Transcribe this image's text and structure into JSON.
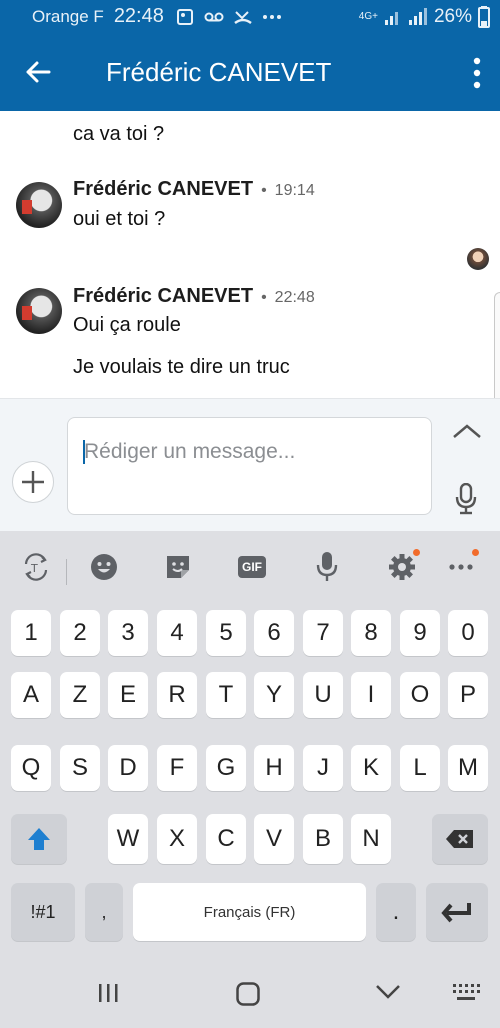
{
  "status": {
    "carrier": "Orange F",
    "time": "22:48",
    "network": "4G+",
    "battery": "26%"
  },
  "appbar": {
    "title": "Frédéric CANEVET"
  },
  "thread": {
    "prev_text": "ca va toi ?",
    "messages": [
      {
        "sender": "Frédéric CANEVET",
        "time": "19:14",
        "lines": [
          "oui et toi ?"
        ]
      },
      {
        "sender": "Frédéric CANEVET",
        "time": "22:48",
        "lines": [
          "Oui ça roule",
          "Je voulais te dire un truc"
        ]
      }
    ],
    "separator": "•"
  },
  "compose": {
    "placeholder": "Rédiger un message..."
  },
  "keyboard": {
    "row_numbers": [
      "1",
      "2",
      "3",
      "4",
      "5",
      "6",
      "7",
      "8",
      "9",
      "0"
    ],
    "row1": [
      "A",
      "Z",
      "E",
      "R",
      "T",
      "Y",
      "U",
      "I",
      "O",
      "P"
    ],
    "row2": [
      "Q",
      "S",
      "D",
      "F",
      "G",
      "H",
      "J",
      "K",
      "L",
      "M"
    ],
    "row3": [
      "W",
      "X",
      "C",
      "V",
      "B",
      "N"
    ],
    "symbols_key": "!#1",
    "comma_key": ",",
    "space_label": "Français (FR)",
    "period_key": ".",
    "gif_label": "GIF",
    "tools": [
      "translate-icon",
      "emoji-icon",
      "sticker-icon",
      "gif-icon",
      "voice-icon",
      "settings-icon",
      "more-icon"
    ]
  },
  "colors": {
    "brand": "#0a66a8",
    "notification_dot": "#f16b2b"
  }
}
